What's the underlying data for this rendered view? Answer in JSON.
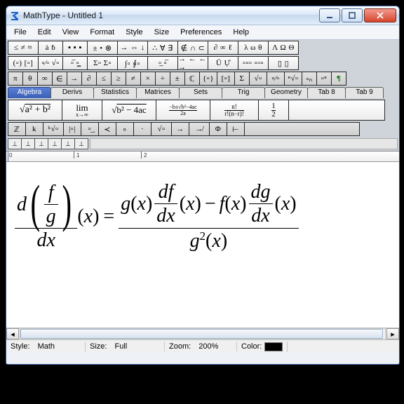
{
  "window": {
    "title": "MathType - Untitled 1"
  },
  "menus": [
    "File",
    "Edit",
    "View",
    "Format",
    "Style",
    "Size",
    "Preferences",
    "Help"
  ],
  "palette_rows": {
    "row1": [
      {
        "g": "≤ ≠ ≈",
        "w": 44
      },
      {
        "g": "ȧ ḃ",
        "w": 36
      },
      {
        "g": "▪ ▪ ▪",
        "w": 36
      },
      {
        "g": "± • ⊗",
        "w": 44
      },
      {
        "g": "→ ⇔ ↓",
        "w": 44
      },
      {
        "g": "∴ ∀ ∃",
        "w": 44
      },
      {
        "g": "∉ ∩ ⊂",
        "w": 44
      },
      {
        "g": "∂ ∞ ℓ",
        "w": 44
      },
      {
        "g": "λ ω θ",
        "w": 44
      },
      {
        "g": "Λ Ω Θ",
        "w": 44
      }
    ],
    "row2": [
      {
        "g": "(▫) [▫]",
        "w": 44
      },
      {
        "g": "▫⁄▫ √▫",
        "w": 36
      },
      {
        "g": "▫̅ ▫͇",
        "w": 36
      },
      {
        "g": "Σ▫ Σ▫",
        "w": 44
      },
      {
        "g": "∫▫ ∮▫",
        "w": 44
      },
      {
        "g": "▫̲ ▫̅",
        "w": 44
      },
      {
        "g": "→ ←\n← →",
        "w": 44
      },
      {
        "g": "Ū Ụ̂",
        "w": 44
      },
      {
        "g": "▫▫▫\n▫▫▫",
        "w": 44
      },
      {
        "g": "▯ ▯",
        "w": 44
      }
    ],
    "row3": [
      {
        "g": "π",
        "w": 22,
        "shade": 1
      },
      {
        "g": "θ",
        "w": 22,
        "shade": 1
      },
      {
        "g": "∞",
        "w": 22,
        "shade": 1
      },
      {
        "g": "∈",
        "w": 22,
        "shade": 1
      },
      {
        "g": "→",
        "w": 22,
        "shade": 1
      },
      {
        "g": "∂",
        "w": 22,
        "shade": 1
      },
      {
        "g": "≤",
        "w": 22,
        "shade": 1
      },
      {
        "g": "≥",
        "w": 22,
        "shade": 1
      },
      {
        "g": "≠",
        "w": 22,
        "shade": 1
      },
      {
        "g": "×",
        "w": 22,
        "shade": 1
      },
      {
        "g": "÷",
        "w": 22,
        "shade": 1
      },
      {
        "g": "±",
        "w": 22,
        "shade": 1
      },
      {
        "g": "ℂ",
        "w": 22,
        "shade": 1
      },
      {
        "g": "{▫}",
        "w": 26,
        "shade": 1
      },
      {
        "g": "[▫]",
        "w": 26,
        "shade": 1
      },
      {
        "g": "Σ",
        "w": 22,
        "shade": 1
      },
      {
        "g": "√▫",
        "w": 26,
        "shade": 1
      },
      {
        "g": "▫⁄▫",
        "w": 26,
        "shade": 1
      },
      {
        "g": "ⁿ√▫",
        "w": 26,
        "shade": 1
      },
      {
        "g": "▫ₙ",
        "w": 22,
        "shade": 1
      },
      {
        "g": "▫ⁿ",
        "w": 22,
        "shade": 1
      },
      {
        "g": "¶",
        "w": 22,
        "shade": 1,
        "green": 1
      }
    ],
    "row4": [
      {
        "g": "ℤ",
        "w": 26,
        "shade": 1
      },
      {
        "g": "k",
        "w": 26,
        "shade": 1
      },
      {
        "g": "ᵏ√▫",
        "w": 30,
        "shade": 1
      },
      {
        "g": "|▫|",
        "w": 26,
        "shade": 1
      },
      {
        "g": "▫͢",
        "w": 26,
        "shade": 1
      },
      {
        "g": "≺",
        "w": 26,
        "shade": 1
      },
      {
        "g": "∘",
        "w": 26,
        "shade": 1
      },
      {
        "g": "·",
        "w": 26,
        "shade": 1
      },
      {
        "g": "√▫",
        "w": 30,
        "shade": 1
      },
      {
        "g": "→",
        "w": 26,
        "shade": 1
      },
      {
        "g": "↛",
        "w": 30,
        "shade": 1
      },
      {
        "g": "Φ",
        "w": 26,
        "shade": 1
      },
      {
        "g": "⊢",
        "w": 26,
        "shade": 1
      },
      {
        "g": "",
        "w": 165,
        "shade": 1
      }
    ]
  },
  "tabs": [
    {
      "label": "Algebra",
      "w": 62,
      "active": true
    },
    {
      "label": "Derivs",
      "w": 62
    },
    {
      "label": "Statistics",
      "w": 62
    },
    {
      "label": "Matrices",
      "w": 62
    },
    {
      "label": "Sets",
      "w": 62
    },
    {
      "label": "Trig",
      "w": 62
    },
    {
      "label": "Geometry",
      "w": 62
    },
    {
      "label": "Tab 8",
      "w": 55
    },
    {
      "label": "Tab 9",
      "w": 55
    }
  ],
  "templates": [
    {
      "html": "<span style='font-size:14px;'>√<span style='text-decoration:overline;'>a² + b²</span></span>",
      "w": 78
    },
    {
      "html": "<span style='display:inline-flex;flex-direction:column;align-items:center;font-size:13px;line-height:1;'><span>lim</span><span style='font-size:8px;'>x→∞</span></span>",
      "w": 58
    },
    {
      "html": "<span style='font-size:13px;'>√<span style='text-decoration:overline;'>b² − 4ac</span></span>",
      "w": 78
    },
    {
      "html": "<span style='display:inline-flex;flex-direction:column;align-items:center;font-size:8px;line-height:1;'><span>−b±√b²−4ac</span><span style='align-self:stretch;border-top:1px solid #000;'></span><span>2a</span></span>",
      "w": 78
    },
    {
      "html": "<span style='display:inline-flex;flex-direction:column;align-items:center;font-size:9px;line-height:1;'><span>n!</span><span style='align-self:stretch;border-top:1px solid #000;'></span><span>r!(n−r)!</span></span>",
      "w": 70
    },
    {
      "html": "<span style='display:inline-flex;flex-direction:column;align-items:center;font-size:11px;line-height:1;'><span>1</span><span style='align-self:stretch;border-top:1px solid #000;'></span><span>2</span></span>",
      "w": 44
    },
    {
      "html": "",
      "w": 138
    }
  ],
  "status": {
    "style_label": "Style:",
    "style": "Math",
    "size_label": "Size:",
    "size": "Full",
    "zoom_label": "Zoom:",
    "zoom": "200%",
    "color_label": "Color:",
    "color": "#000000"
  },
  "equation_text": "d(f/g)/dx (x) = ( g(x) df/dx (x) − f(x) dg/dx (x) ) / g²(x)"
}
